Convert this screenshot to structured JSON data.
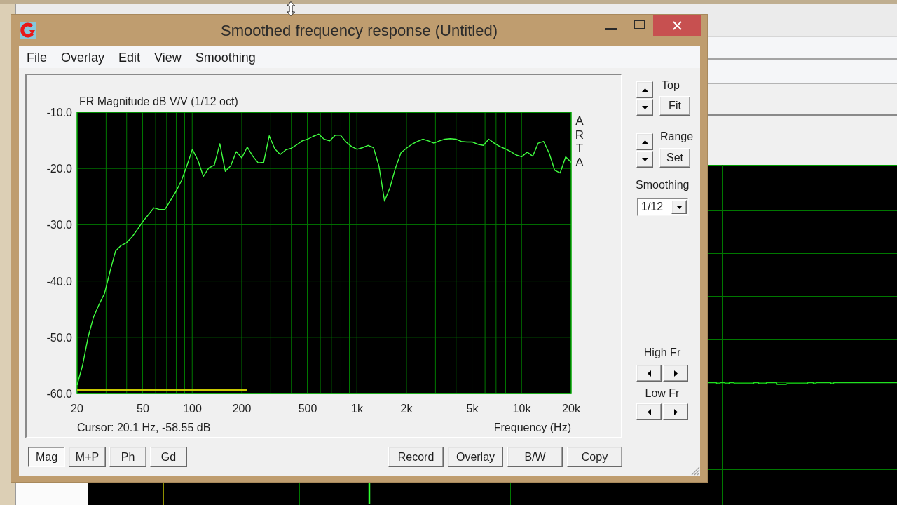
{
  "window": {
    "title": "Smoothed frequency response (Untitled)"
  },
  "menu": [
    "File",
    "Overlay",
    "Edit",
    "View",
    "Smoothing"
  ],
  "plot": {
    "chart_data": {
      "type": "line",
      "title": "FR Magnitude dB V/V (1/12 oct)",
      "xlabel": "Frequency (Hz)",
      "grid": true,
      "categories": [
        "20",
        null,
        null,
        null,
        null,
        null,
        null,
        null,
        null,
        null,
        null,
        null,
        "50",
        null,
        null,
        null,
        null,
        null,
        null,
        null,
        null,
        "100",
        null,
        null,
        null,
        null,
        null,
        null,
        null,
        null,
        "200",
        null,
        null,
        null,
        null,
        null,
        null,
        null,
        null,
        null,
        null,
        null,
        "500",
        null,
        null,
        null,
        null,
        null,
        null,
        null,
        null,
        "1k",
        null,
        null,
        null,
        null,
        null,
        null,
        null,
        null,
        "2k",
        null,
        null,
        null,
        null,
        null,
        null,
        null,
        null,
        null,
        null,
        null,
        "5k",
        null,
        null,
        null,
        null,
        null,
        null,
        null,
        null,
        "10k",
        null,
        null,
        null,
        null,
        null,
        null,
        null,
        null,
        "20k"
      ],
      "series": [
        {
          "color": "#40ff40",
          "values": [
            -58.5,
            -55.0,
            -50.0,
            -46.4,
            -44.2,
            -42.2,
            -38.3,
            -34.7,
            -33.7,
            -33.2,
            -32.2,
            -30.8,
            -29.4,
            -28.2,
            -27.0,
            -27.3,
            -27.3,
            -25.7,
            -24.1,
            -22.2,
            -19.5,
            -16.6,
            -18.5,
            -21.4,
            -19.9,
            -19.4,
            -15.6,
            -20.5,
            -19.5,
            -17.0,
            -18.1,
            -16.2,
            -17.8,
            -19.0,
            -18.9,
            -14.2,
            -16.5,
            -17.5,
            -16.7,
            -16.4,
            -15.8,
            -15.1,
            -14.8,
            -14.3,
            -13.9,
            -14.8,
            -15.1,
            -14.1,
            -14.1,
            -15.3,
            -16.1,
            -16.6,
            -16.3,
            -15.9,
            -16.3,
            -19.6,
            -25.8,
            -23.4,
            -19.9,
            -17.2,
            -16.4,
            -15.7,
            -15.2,
            -14.8,
            -15.1,
            -15.5,
            -15.1,
            -14.8,
            -14.7,
            -14.8,
            -15.2,
            -15.3,
            -15.3,
            -15.7,
            -15.9,
            -14.8,
            -15.5,
            -16.1,
            -16.5,
            -17.0,
            -17.6,
            -17.9,
            -17.1,
            -17.8,
            -15.5,
            -15.2,
            -17.3,
            -20.3,
            -20.8,
            -17.9,
            -18.9
          ]
        },
        {
          "color": "#c8c800",
          "values": [
            -59.3,
            -59.3,
            -59.3,
            -59.3,
            -59.3,
            -59.3,
            -59.3,
            -59.3,
            -59.3,
            -59.3,
            -59.3,
            -59.3,
            -59.3,
            -59.3,
            -59.3,
            -59.3,
            -59.3,
            -59.3,
            -59.3,
            -59.3,
            -59.3,
            -59.3,
            -59.3,
            -59.3,
            -59.3,
            -59.3,
            -59.3,
            -59.3,
            -59.3,
            -59.3,
            -59.3,
            -59.3,
            null,
            null,
            null,
            null,
            null,
            null,
            null,
            null,
            null,
            null,
            null,
            null,
            null,
            null,
            null,
            null,
            null,
            null,
            null,
            null,
            null,
            null,
            null,
            null,
            null,
            null,
            null,
            null,
            null,
            null,
            null,
            null,
            null,
            null,
            null,
            null,
            null,
            null,
            null,
            null,
            null,
            null,
            null,
            null,
            null,
            null,
            null,
            null,
            null,
            null,
            null,
            null,
            null,
            null,
            null,
            null,
            null,
            null,
            null
          ]
        }
      ],
      "ylim": [
        -60,
        -10
      ],
      "yticks": [
        {
          "value": -10,
          "label": "-10.0"
        },
        {
          "value": -20,
          "label": "-20.0"
        },
        {
          "value": -30,
          "label": "-30.0"
        },
        {
          "value": -40,
          "label": "-40.0"
        },
        {
          "value": -50,
          "label": "-50.0"
        },
        {
          "value": -60,
          "label": "-60.0"
        }
      ]
    },
    "side_label": "ARTA",
    "cursor_readout": "Cursor: 20.1 Hz, -58.55 dB"
  },
  "side_panel": {
    "top": {
      "label": "Top",
      "button": "Fit"
    },
    "range": {
      "label": "Range",
      "button": "Set"
    },
    "smoothing": {
      "label": "Smoothing",
      "value": "1/12"
    },
    "high_fr": {
      "label": "High Fr"
    },
    "low_fr": {
      "label": "Low Fr"
    }
  },
  "view_buttons": [
    {
      "label": "Mag",
      "selected": true
    },
    {
      "label": "M+P",
      "selected": false
    },
    {
      "label": "Ph",
      "selected": false
    },
    {
      "label": "Gd",
      "selected": false
    }
  ],
  "action_buttons": [
    "Record",
    "Overlay",
    "B/W",
    "Copy"
  ]
}
